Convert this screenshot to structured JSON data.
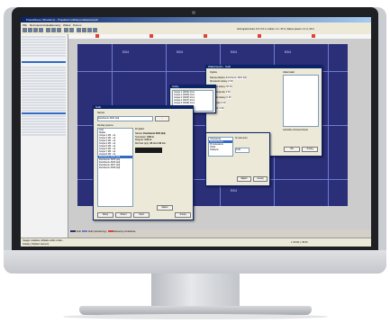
{
  "window": {
    "title": "Posadzkowy (Sheetbox) - Projektant sufitów podwieszanych"
  },
  "menu": {
    "items": [
      "Plik",
      "Rozmieszczanie",
      "Elementy",
      "Widok",
      "Pomoc"
    ]
  },
  "header": {
    "message": "Grid ograniczenia: 0.6 / 0.6 m; zakres: 1.2 - 60 m; Zakres panelu: 1.2 m, 60 m"
  },
  "tiles": {
    "labels": [
      "B54",
      "B54",
      "B54",
      "B54",
      "B54",
      "B54",
      "B54"
    ]
  },
  "dialog_ceiling": {
    "title": "Sufit",
    "field_name": "Nazwa:",
    "name_value": "Zwolnienie 3404 (kd)",
    "section_label": "Rodzaj systemu",
    "list_items": [
      "Grid",
      "Siatka",
      "Grupa 1 M4 - ok",
      "Grupa 2 M4 - ok",
      "Grupa 3 M4 - ok",
      "Grupa 4 M4 - ok",
      "Grupa 5 M4 - ok",
      "Grupa 6 M4 - ok",
      "Grupa 7 M4 - ok",
      "Grupa 8 M4 - ok",
      "Zwolnienie 3404 (kd)",
      "Zwolnienie 3405 (kd)",
      "Zwolnienie 3406 (kd)",
      "Zwolnienie 3407 (kd)",
      "Zwolnienie 3408 (kd)"
    ],
    "selected_index": 10,
    "example_label": "Przykład:",
    "props": [
      {
        "k": "Nazwa:",
        "v": "Zwolnienie 3404 (kd)"
      },
      {
        "k": "Szerokość:",
        "v": "0.60 m"
      },
      {
        "k": "Długość:",
        "v": "0.60 m"
      },
      {
        "k": "Rozmiar płyty:",
        "v": "60 cm x 60 cm"
      }
    ],
    "ok": "Zapisz",
    "buttons": [
      "Nowy",
      "Zmień",
      "Usuń",
      "Anuluj"
    ]
  },
  "dialog_props": {
    "title": "Właściwości - Sufit",
    "tab1": "Ogólne",
    "rows": [
      {
        "k": "Nazwa obiektu:",
        "v": "Zwolnienie 3404 (kd)"
      },
      {
        "k": "Wysokość ściany:",
        "v": "2.50"
      },
      {
        "k": "Długość ściany:",
        "v": "60.00"
      },
      {
        "k": "Kąt pochylenia:",
        "v": "0.00"
      },
      {
        "k": "Grubość ściany:",
        "v": "0.25"
      },
      {
        "k": "Wysokość:",
        "v": "0.00"
      },
      {
        "k": "Długość:",
        "v": "0.00"
      }
    ],
    "right_title": "Układ siatki",
    "checkbox": "Jednolite rozmieszczenie",
    "ok": "OK",
    "cancel": "Anuluj"
  },
  "dialog_list": {
    "title": "Sufity",
    "items": [
      "Grupa 1 (3404) 2mm",
      "Grupa 2 (3405) 2mm",
      "Grupa 3 (3406) 2mm",
      "Grupa 4 (3407) 2mm",
      "Grupa 5 (3408) 2mm"
    ]
  },
  "dialog_small": {
    "items": [
      "Uziemienie",
      "Wykończenie",
      "Przeniesienie",
      "Obrót",
      "Odcięcie"
    ],
    "selected_index": 1,
    "label": "Nr elementu",
    "field": "0.00",
    "ok": "Zapisz",
    "cancel": "Anuluj"
  },
  "legend": {
    "items": [
      "Sufit",
      "Sufit (zaznaczony)",
      "Elementy montażowe"
    ]
  },
  "status": {
    "line1": "Uwaga: ustalanie rozkładu sufitu w toku...",
    "line2": "Gotowy | Wybierz element",
    "pos": "x: 60.00  y: 35.00"
  },
  "colors": {
    "ceiling": "#2b2f78",
    "grid": "#6f7bd0",
    "accent": "#0a246a",
    "marker": "#dd4433"
  }
}
